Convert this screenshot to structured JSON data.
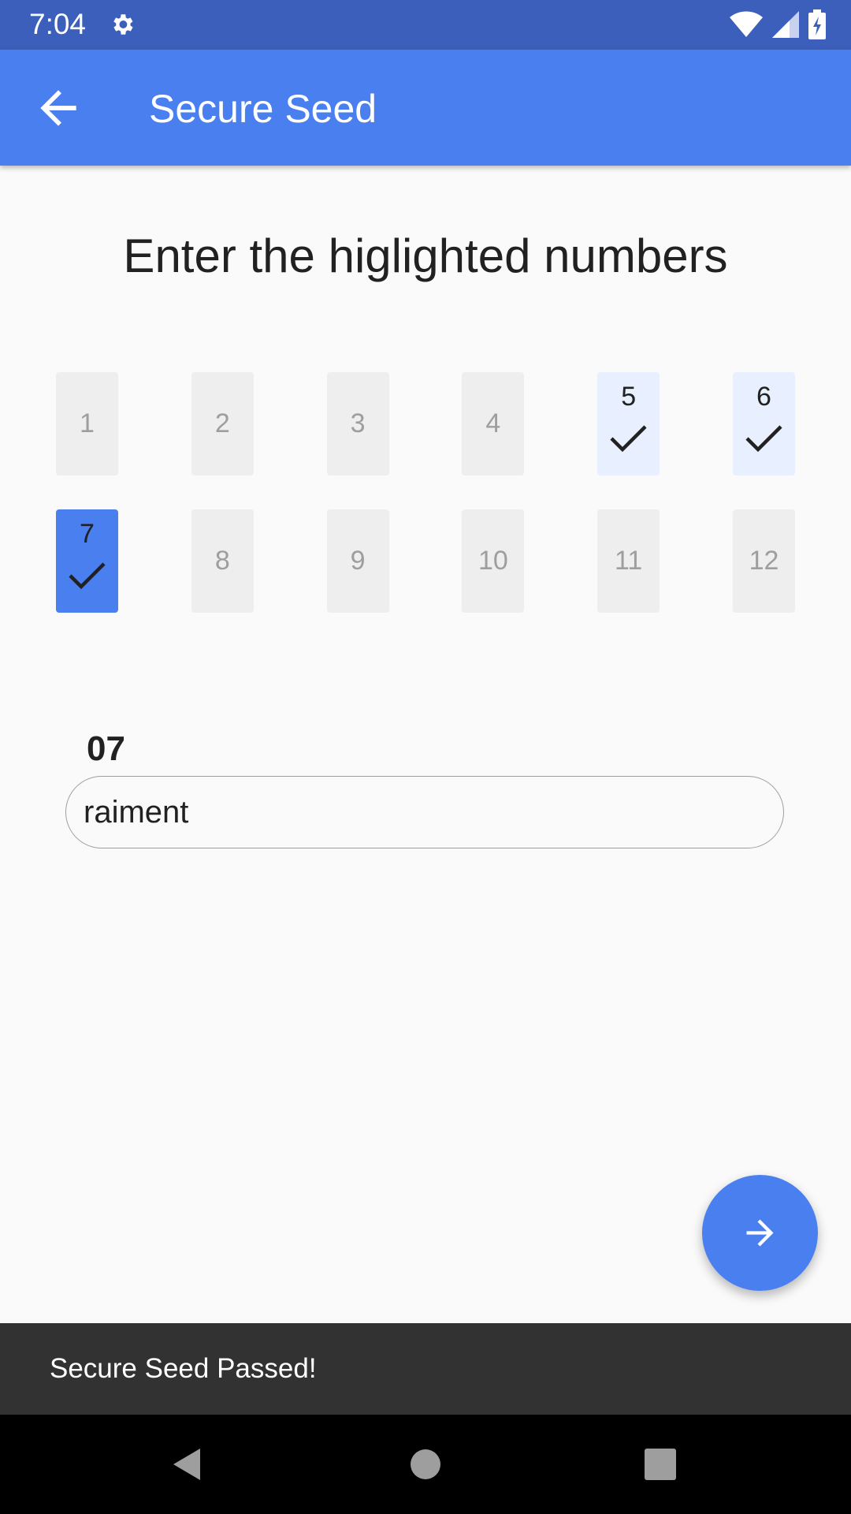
{
  "status_bar": {
    "time": "7:04",
    "icons": [
      "gear-icon",
      "wifi-icon",
      "signal-icon",
      "battery-icon"
    ]
  },
  "app_bar": {
    "title": "Secure Seed",
    "back_icon": "arrow-left-icon"
  },
  "heading": "Enter the higlighted numbers",
  "seed_words": [
    {
      "label": "1",
      "state": "default"
    },
    {
      "label": "2",
      "state": "default"
    },
    {
      "label": "3",
      "state": "default"
    },
    {
      "label": "4",
      "state": "default"
    },
    {
      "label": "5",
      "state": "done"
    },
    {
      "label": "6",
      "state": "done"
    },
    {
      "label": "7",
      "state": "current"
    },
    {
      "label": "8",
      "state": "default"
    },
    {
      "label": "9",
      "state": "default"
    },
    {
      "label": "10",
      "state": "default"
    },
    {
      "label": "11",
      "state": "default"
    },
    {
      "label": "12",
      "state": "default"
    }
  ],
  "word_entry": {
    "label": "07",
    "value": "raiment"
  },
  "fab": {
    "icon": "arrow-right-icon"
  },
  "snackbar": {
    "message": "Secure Seed Passed!"
  },
  "colors": {
    "primary": "#4a7ff0",
    "status_bar": "#3b5fba",
    "done_bg": "#e8effe",
    "snackbar": "#323232"
  }
}
